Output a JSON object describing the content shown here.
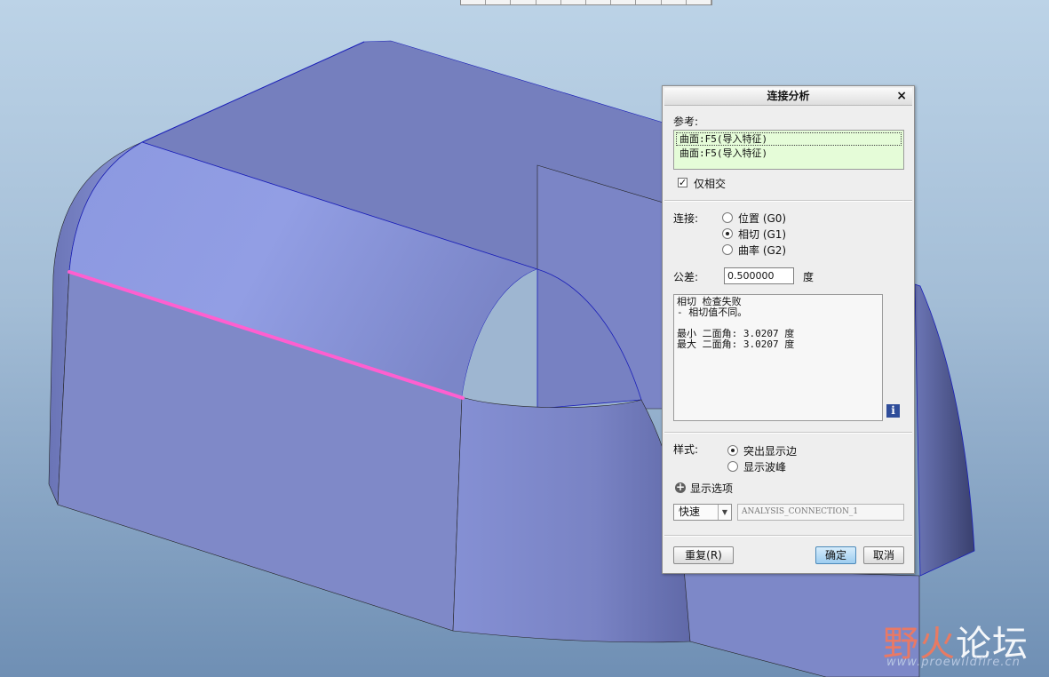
{
  "dialog": {
    "title": "连接分析",
    "close_glyph": "×",
    "reference_label": "参考:",
    "references": [
      "曲面:F5(导入特征)",
      "曲面:F5(导入特征)"
    ],
    "intersect_only_label": "仅相交",
    "intersect_only_checked": true,
    "connection_label": "连接:",
    "connection_options": [
      {
        "label": "位置 (G0)",
        "selected": false
      },
      {
        "label": "相切 (G1)",
        "selected": true
      },
      {
        "label": "曲率 (G2)",
        "selected": false
      }
    ],
    "tolerance_label": "公差:",
    "tolerance_value": "0.500000",
    "tolerance_unit": "度",
    "results": "相切 检查失败\n- 相切值不同。\n\n最小 二面角: 3.0207 度\n最大 二面角: 3.0207 度",
    "info_glyph": "i",
    "style_label": "样式:",
    "style_options": [
      {
        "label": "突出显示边",
        "selected": true
      },
      {
        "label": "显示波峰",
        "selected": false
      }
    ],
    "display_options_label": "显示选项",
    "speed_value": "快速",
    "analysis_name": "ANALYSIS_CONNECTION_1",
    "repeat_button": "重复(R)",
    "ok_button": "确定",
    "cancel_button": "取消"
  },
  "watermark": {
    "text_a": "野火",
    "text_b": "论坛",
    "url": "www.proewildfire.cn"
  },
  "colors": {
    "surface": "#7d86c6",
    "highlight_edge": "#ff5fd0",
    "edge": "#1a1fb8"
  }
}
